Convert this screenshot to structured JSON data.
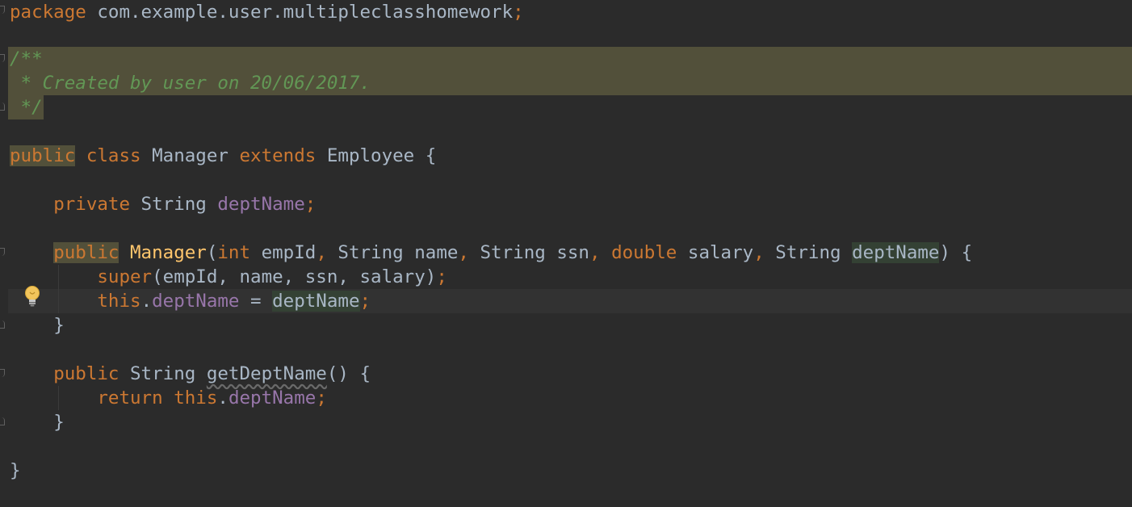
{
  "editor": {
    "background": "#2b2b2b",
    "colors": {
      "keyword": "#cc7832",
      "plain": "#a9b7c6",
      "field": "#9876aa",
      "method": "#ffc66d",
      "doc_comment": "#629755",
      "comment_highlight": "#52503a",
      "usage_highlight": "#344134"
    },
    "code": {
      "pkg_kw": "package",
      "pkg_name": " com.example.user.multipleclasshomework",
      "semi": ";",
      "doc_open": "/**",
      "doc_body": " * Created by user on 20/06/2017.",
      "doc_close": " */",
      "kw_public": "public",
      "kw_class": " class ",
      "class_name": "Manager",
      "kw_extends": " extends ",
      "super_class": "Employee",
      "brace_open": " {",
      "indent1": "    ",
      "indent2": "        ",
      "kw_private": "private",
      "type_string": " String ",
      "field_dept": "deptName",
      "ctor_name": "Manager",
      "paren_open": "(",
      "kw_int": "int",
      "param_empid": " empId",
      "comma": ", ",
      "type_string_plain": "String",
      "param_name": " name",
      "param_ssn": " ssn",
      "kw_double": "double",
      "param_salary": " salary",
      "param_dept": "deptName",
      "paren_close_brace": ") {",
      "kw_super": "super",
      "super_args": "(empId, name, ssn, salary)",
      "kw_this": "this",
      "dot": ".",
      "assign": " = ",
      "brace_close": "}",
      "getter_name": "getDeptName",
      "getter_parens": "() {",
      "kw_return": "return",
      "space": " "
    }
  },
  "icons": {
    "intention": "lightbulb-icon",
    "fold": "fold-marker-icon"
  }
}
